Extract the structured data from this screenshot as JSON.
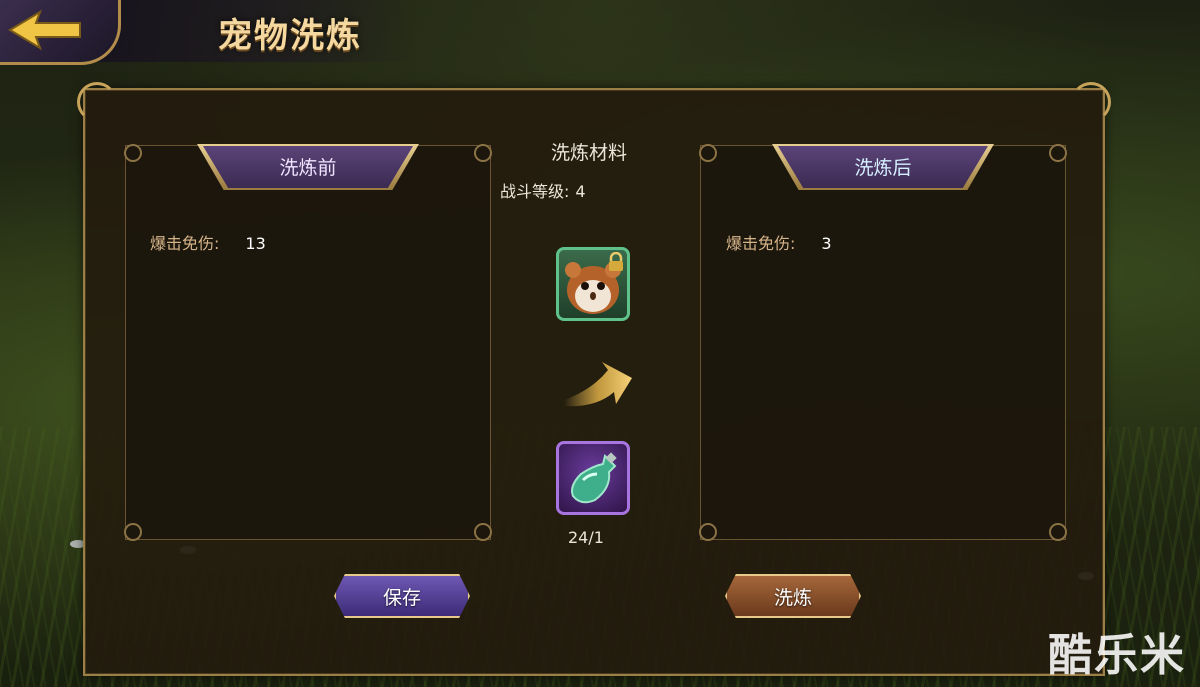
{
  "header": {
    "title": "宠物洗炼"
  },
  "before_panel": {
    "title": "洗炼前",
    "stat_label": "爆击免伤:",
    "stat_value": "13"
  },
  "after_panel": {
    "title": "洗炼后",
    "stat_label": "爆击免伤:",
    "stat_value": "3"
  },
  "materials": {
    "title": "洗炼材料",
    "level_label": "战斗等级:",
    "level_value": "4",
    "item_count": "24/1",
    "pet_icon": "hamster-pet-icon",
    "item_icon": "green-potion-icon"
  },
  "buttons": {
    "save_label": "保存",
    "refine_label": "洗炼"
  },
  "watermark": "酷乐米",
  "colors": {
    "accent_gold": "#c8a35a",
    "stat_label": "#d6b48a",
    "save_button": "#5a48a0",
    "refine_button": "#8e5330"
  }
}
